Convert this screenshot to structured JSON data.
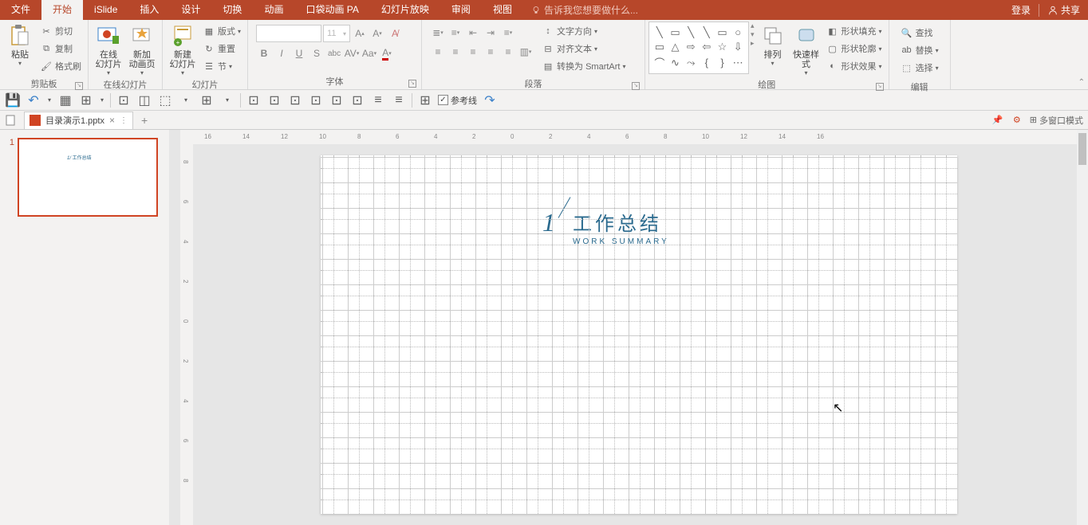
{
  "menubar": {
    "tabs": [
      "文件",
      "开始",
      "iSlide",
      "插入",
      "设计",
      "切换",
      "动画",
      "口袋动画 PA",
      "幻灯片放映",
      "审阅",
      "视图"
    ],
    "active_index": 1,
    "tellme": "告诉我您想要做什么...",
    "login": "登录",
    "share": "共享"
  },
  "ribbon": {
    "clipboard": {
      "label": "剪贴板",
      "paste": "粘贴",
      "cut": "剪切",
      "copy": "复制",
      "format_painter": "格式刷"
    },
    "online_slides": {
      "label": "在线幻灯片",
      "online": "在线\n幻灯片",
      "new_anim": "新加\n动画页"
    },
    "slides": {
      "label": "幻灯片",
      "new_slide": "新建\n幻灯片",
      "layout": "版式",
      "reset": "重置",
      "section": "节"
    },
    "font": {
      "label": "字体",
      "size": "11",
      "name": ""
    },
    "paragraph": {
      "label": "段落",
      "text_direction": "文字方向",
      "align_text": "对齐文本",
      "convert_smartart": "转换为 SmartArt"
    },
    "drawing": {
      "label": "绘图",
      "arrange": "排列",
      "quick_styles": "快速样式",
      "shape_fill": "形状填充",
      "shape_outline": "形状轮廓",
      "shape_effects": "形状效果"
    },
    "editing": {
      "label": "编辑",
      "find": "查找",
      "replace": "替换",
      "select": "选择"
    }
  },
  "qat": {
    "guides": "参考线"
  },
  "tabbar": {
    "filename": "目录演示1.pptx",
    "multiwin": "多窗口模式"
  },
  "thumbs": {
    "num": "1"
  },
  "slide": {
    "num": "1",
    "title_cn": "工作总结",
    "title_en": "WORK SUMMARY"
  },
  "ruler_h": [
    "16",
    "14",
    "12",
    "10",
    "8",
    "6",
    "4",
    "2",
    "0",
    "2",
    "4",
    "6",
    "8",
    "10",
    "12",
    "14",
    "16"
  ],
  "ruler_v": [
    "8",
    "6",
    "4",
    "2",
    "0",
    "2",
    "4",
    "6",
    "8"
  ]
}
